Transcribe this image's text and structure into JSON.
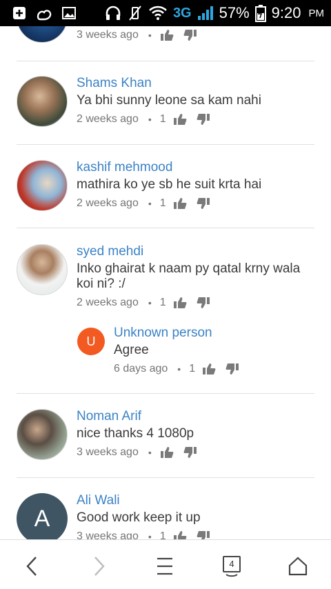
{
  "status_bar": {
    "network": "3G",
    "battery": "57%",
    "time": "9:20",
    "ampm": "PM"
  },
  "colors": {
    "author": "#3b82c6",
    "unknown_avatar": "#f25a22",
    "ali_avatar": "#3f5564"
  },
  "comments": [
    {
      "time": "3 weeks ago"
    },
    {
      "author": "Shams Khan",
      "text": "Ya bhi sunny leone sa kam nahi",
      "time": "2 weeks ago",
      "likes": "1"
    },
    {
      "author": "kashif mehmood",
      "text": "mathira ko ye sb he suit krta hai",
      "time": "2 weeks ago",
      "likes": "1"
    },
    {
      "author": "syed mehdi",
      "text": "Inko ghairat k naam py qatal krny wala koi ni? :/",
      "time": "2 weeks ago",
      "likes": "1",
      "reply": {
        "author": "Unknown person",
        "avatar_letter": "U",
        "text": "Agree",
        "time": "6 days ago",
        "likes": "1"
      }
    },
    {
      "author": "Noman Arif",
      "text": "nice thanks 4 1080p",
      "time": "3 weeks ago"
    },
    {
      "author": "Ali Wali",
      "avatar_letter": "A",
      "text": "Good work keep it up",
      "time": "3 weeks ago",
      "likes": "1"
    }
  ],
  "bottom_nav": {
    "tabs_count": "4"
  }
}
